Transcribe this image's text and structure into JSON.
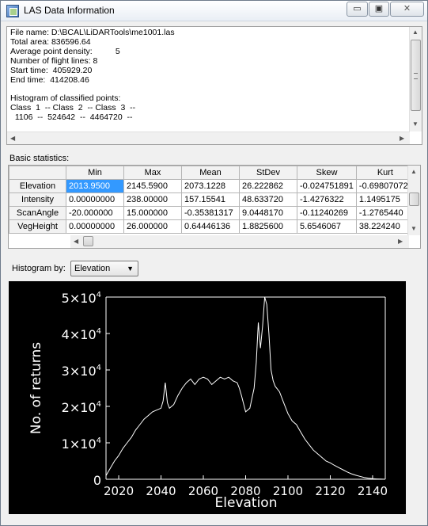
{
  "window": {
    "title": "LAS Data Information",
    "minimize_glyph": "▭",
    "maximize_glyph": "▣",
    "close_glyph": "✕"
  },
  "info_lines": [
    "File name: D:\\BCAL\\LiDARTools\\me1001.las",
    "Total area: 836596.64",
    "Average point density:          5",
    "Number of flight lines: 8",
    "Start time:  405929.20",
    "End time:  414208.46",
    "",
    "Histogram of classified points:",
    "Class  1  -- Class  2  -- Class  3  --",
    "  1106  --  524642  --  4464720  --"
  ],
  "stats": {
    "label": "Basic statistics:",
    "columns": [
      "Min",
      "Max",
      "Mean",
      "StDev",
      "Skew",
      "Kurt"
    ],
    "rows": [
      {
        "name": "Elevation",
        "values": [
          "2013.9500",
          "2145.5900",
          "2073.1228",
          "26.222862",
          "-0.024751891",
          "-0.69807072"
        ]
      },
      {
        "name": "Intensity",
        "values": [
          "0.00000000",
          "238.00000",
          "157.15541",
          "48.633720",
          "-1.4276322",
          "1.1495175"
        ]
      },
      {
        "name": "ScanAngle",
        "values": [
          "-20.000000",
          "15.000000",
          "-0.35381317",
          "9.0448170",
          "-0.11240269",
          "-1.2765440"
        ]
      },
      {
        "name": "VegHeight",
        "values": [
          "0.00000000",
          "26.000000",
          "0.64446136",
          "1.8825600",
          "5.6546067",
          "38.224240"
        ]
      }
    ]
  },
  "histogram_by": {
    "label": "Histogram by:",
    "selected": "Elevation"
  },
  "chart_data": {
    "type": "line",
    "xlabel": "Elevation",
    "ylabel": "No. of returns",
    "xlim": [
      2014,
      2146
    ],
    "ylim": [
      0,
      50000
    ],
    "x_ticks": [
      "2020",
      "2040",
      "2060",
      "2080",
      "2100",
      "2120",
      "2140"
    ],
    "y_ticks": [
      {
        "mantissa": "0",
        "exp": ""
      },
      {
        "mantissa": "1×10",
        "exp": "4"
      },
      {
        "mantissa": "2×10",
        "exp": "4"
      },
      {
        "mantissa": "3×10",
        "exp": "4"
      },
      {
        "mantissa": "4×10",
        "exp": "4"
      },
      {
        "mantissa": "5×10",
        "exp": "4"
      }
    ],
    "background": "#000000",
    "line_color": "#ffffff",
    "x": [
      2014,
      2016,
      2018,
      2020,
      2022,
      2024,
      2026,
      2028,
      2030,
      2032,
      2034,
      2036,
      2038,
      2040,
      2041,
      2042,
      2043,
      2044,
      2046,
      2048,
      2050,
      2052,
      2054,
      2056,
      2058,
      2060,
      2062,
      2064,
      2066,
      2068,
      2070,
      2072,
      2074,
      2076,
      2077,
      2078,
      2080,
      2082,
      2084,
      2085,
      2086,
      2087,
      2088,
      2089,
      2090,
      2091,
      2092,
      2093,
      2094,
      2096,
      2098,
      2100,
      2102,
      2104,
      2106,
      2108,
      2110,
      2112,
      2114,
      2116,
      2118,
      2120,
      2122,
      2124,
      2126,
      2128,
      2130,
      2132,
      2134,
      2136,
      2138,
      2140,
      2142,
      2144,
      2146
    ],
    "values": [
      1000,
      3000,
      5000,
      6500,
      8500,
      10000,
      11500,
      13500,
      15000,
      16500,
      17500,
      18500,
      19000,
      19500,
      21500,
      26500,
      21000,
      19500,
      20500,
      23000,
      25000,
      26500,
      27500,
      26000,
      27500,
      28000,
      27500,
      26000,
      27000,
      28000,
      27500,
      28000,
      27000,
      26500,
      25000,
      23000,
      18500,
      19500,
      25000,
      32000,
      43000,
      36000,
      42000,
      50000,
      48000,
      40000,
      30000,
      27000,
      25500,
      24000,
      21000,
      18000,
      16000,
      15000,
      13000,
      11000,
      9500,
      8000,
      7000,
      6000,
      5000,
      4500,
      3800,
      3200,
      2600,
      2000,
      1500,
      1100,
      800,
      500,
      300,
      150,
      80,
      40,
      0
    ]
  }
}
